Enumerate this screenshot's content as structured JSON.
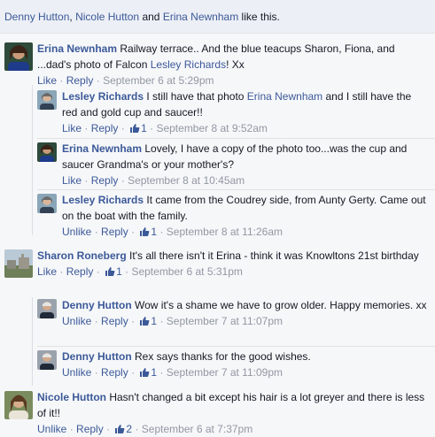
{
  "likes_bar": {
    "people": [
      "Denny Hutton",
      "Nicole Hutton",
      "Erina Newnham"
    ],
    "sep1": ", ",
    "sep2": " and ",
    "suffix": " like this."
  },
  "actions": {
    "like": "Like",
    "unlike": "Unlike",
    "reply": "Reply",
    "dot": "·"
  },
  "comments": [
    {
      "author": "Erina Newnham",
      "text_parts": [
        "Railway terrace.. And the blue teacups Sharon, Fiona, and ...dad's photo of Falcon ",
        "Lesley Richards",
        "! Xx"
      ],
      "action": "Like",
      "likes": "",
      "time": "September 6 at 5:29pm"
    },
    {
      "author": "Lesley Richards",
      "text_parts": [
        "I still have that photo ",
        "Erina Newnham",
        " and I still have the red and gold cup and saucer!!"
      ],
      "action": "Like",
      "likes": "1",
      "time": "September 8 at 9:52am"
    },
    {
      "author": "Erina Newnham",
      "text_parts": [
        "Lovely, I have a copy of the photo too...was the cup and saucer Grandma's or your mother's?"
      ],
      "action": "Like",
      "likes": "",
      "time": "September 8 at 10:45am"
    },
    {
      "author": "Lesley Richards",
      "text_parts": [
        "It came from the Coudrey side, from Aunty Gerty. Came out on the boat with the family."
      ],
      "action": "Unlike",
      "likes": "1",
      "time": "September 8 at 11:26am"
    },
    {
      "author": "Sharon Roneberg",
      "text_parts": [
        "It's all there isn't it Erina - think it was Knowltons 21st birthday"
      ],
      "action": "Like",
      "likes": "1",
      "time": "September 6 at 5:31pm"
    },
    {
      "author": "Denny Hutton",
      "text_parts": [
        "Wow it's a shame we have to grow older. Happy memories. xx"
      ],
      "action": "Unlike",
      "likes": "1",
      "time": "September 7 at 11:07pm"
    },
    {
      "author": "Denny Hutton",
      "text_parts": [
        "Rex says thanks for the good wishes."
      ],
      "action": "Unlike",
      "likes": "1",
      "time": "September 7 at 11:09pm"
    },
    {
      "author": "Nicole Hutton",
      "text_parts": [
        "Hasn't changed a bit except his hair is a lot greyer and there is less of it!!"
      ],
      "action": "Unlike",
      "likes": "2",
      "time": "September 6 at 7:37pm"
    }
  ],
  "colors": {
    "link": "#3b5998",
    "meta": "#9197a3",
    "panel": "#f6f7f9",
    "likes_bar": "#eceff5"
  }
}
